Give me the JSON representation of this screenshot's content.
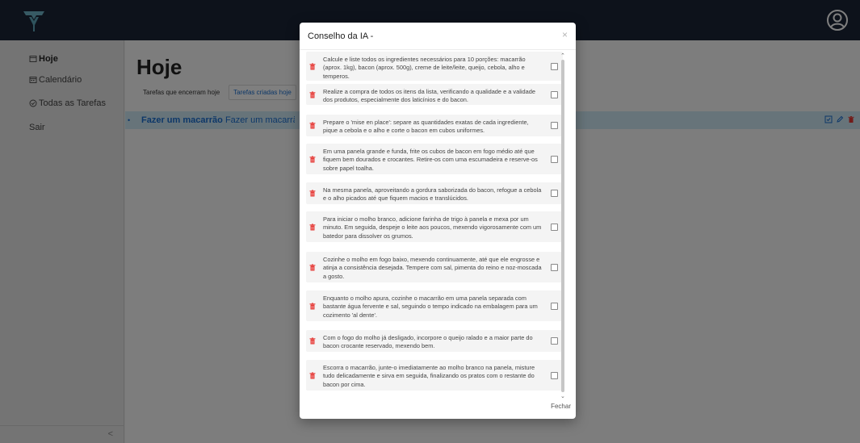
{
  "sidebar": {
    "items": [
      {
        "label": "Hoje",
        "icon": "today-icon"
      },
      {
        "label": "Calendário",
        "icon": "calendar-icon"
      },
      {
        "label": "Todas as Tarefas",
        "icon": "all-tasks-icon"
      },
      {
        "label": "Sair",
        "icon": ""
      }
    ],
    "collapse_label": "<"
  },
  "main": {
    "title": "Hoje",
    "tabs": [
      {
        "label": "Tarefas que encerram hoje",
        "active": false
      },
      {
        "label": "Tarefas criadas hoje",
        "active": true
      }
    ],
    "task": {
      "bullet": "•",
      "title": "Fazer um macarrão",
      "description": "Fazer um macarrão com m"
    }
  },
  "modal": {
    "title": "Conselho da IA -",
    "close_label": "×",
    "close_button_label": "Fechar",
    "steps": [
      {
        "text": "Calcule e liste todos os ingredientes necessários para 10 porções: macarrão (aprox. 1kg), bacon (aprox. 500g), creme de leite/leite, queijo, cebola, alho e temperos."
      },
      {
        "text": "Realize a compra de todos os itens da lista, verificando a qualidade e a validade dos produtos, especialmente dos laticínios e do bacon."
      },
      {
        "text": "Prepare o 'mise en place': separe as quantidades exatas de cada ingrediente, pique a cebola e o alho e corte o bacon em cubos uniformes."
      },
      {
        "text": "Em uma panela grande e funda, frite os cubos de bacon em fogo médio até que fiquem bem dourados e crocantes. Retire-os com uma escumadeira e reserve-os sobre papel toalha."
      },
      {
        "text": "Na mesma panela, aproveitando a gordura saborizada do bacon, refogue a cebola e o alho picados até que fiquem macios e translúcidos."
      },
      {
        "text": "Para iniciar o molho branco, adicione farinha de trigo à panela e mexa por um minuto. Em seguida, despeje o leite aos poucos, mexendo vigorosamente com um batedor para dissolver os grumos."
      },
      {
        "text": "Cozinhe o molho em fogo baixo, mexendo continuamente, até que ele engrosse e atinja a consistência desejada. Tempere com sal, pimenta do reino e noz-moscada a gosto."
      },
      {
        "text": "Enquanto o molho apura, cozinhe o macarrão em uma panela separada com bastante água fervente e sal, seguindo o tempo indicado na embalagem para um cozimento 'al dente'."
      },
      {
        "text": "Com o fogo do molho já desligado, incorpore o queijo ralado e a maior parte do bacon crocante reservado, mexendo bem."
      },
      {
        "text": "Escorra o macarrão, junte-o imediatamente ao molho branco na panela, misture tudo delicadamente e sirva em seguida, finalizando os pratos com o restante do bacon por cima."
      }
    ]
  },
  "colors": {
    "topbar": "#1b2436",
    "accent": "#1a6fd1",
    "danger": "#e53935",
    "task_row": "#cfe8f5"
  }
}
